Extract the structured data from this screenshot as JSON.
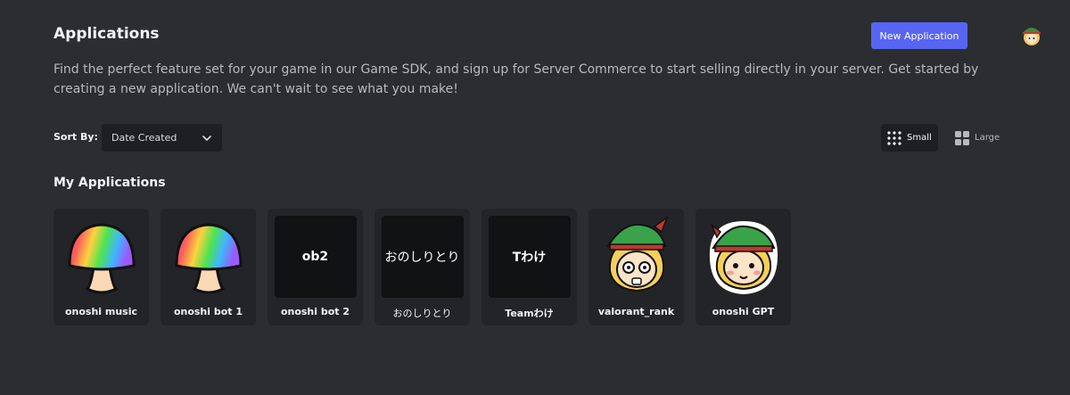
{
  "header": {
    "title": "Applications",
    "new_app_label": "New Application",
    "description": "Find the perfect feature set for your game in our Game SDK, and sign up for Server Commerce to start selling directly in your server. Get started by creating a new application. We can't wait to see what you make!"
  },
  "sort": {
    "label": "Sort By:",
    "value": "Date Created"
  },
  "size_toggle": {
    "small_label": "Small",
    "large_label": "Large",
    "selected": "Small"
  },
  "section": {
    "title": "My Applications"
  },
  "apps": [
    {
      "name": "onoshi music",
      "icon": "rainbow-mushroom-icon"
    },
    {
      "name": "onoshi bot 1",
      "icon": "rainbow-mushroom-icon"
    },
    {
      "name": "onoshi bot 2",
      "icon_text": "ob2"
    },
    {
      "name": "おのしりとり",
      "icon_text": "おのしりとり"
    },
    {
      "name": "Teamわけ",
      "icon_text": "Tわけ"
    },
    {
      "name": "valorant_rank",
      "icon": "blonde-girl-green-hat-icon"
    },
    {
      "name": "onoshi GPT",
      "icon": "blonde-girl-green-hat-sticker-icon"
    }
  ],
  "colors": {
    "background": "#2b2d31",
    "accent": "#5865f2",
    "card": "#232428"
  }
}
